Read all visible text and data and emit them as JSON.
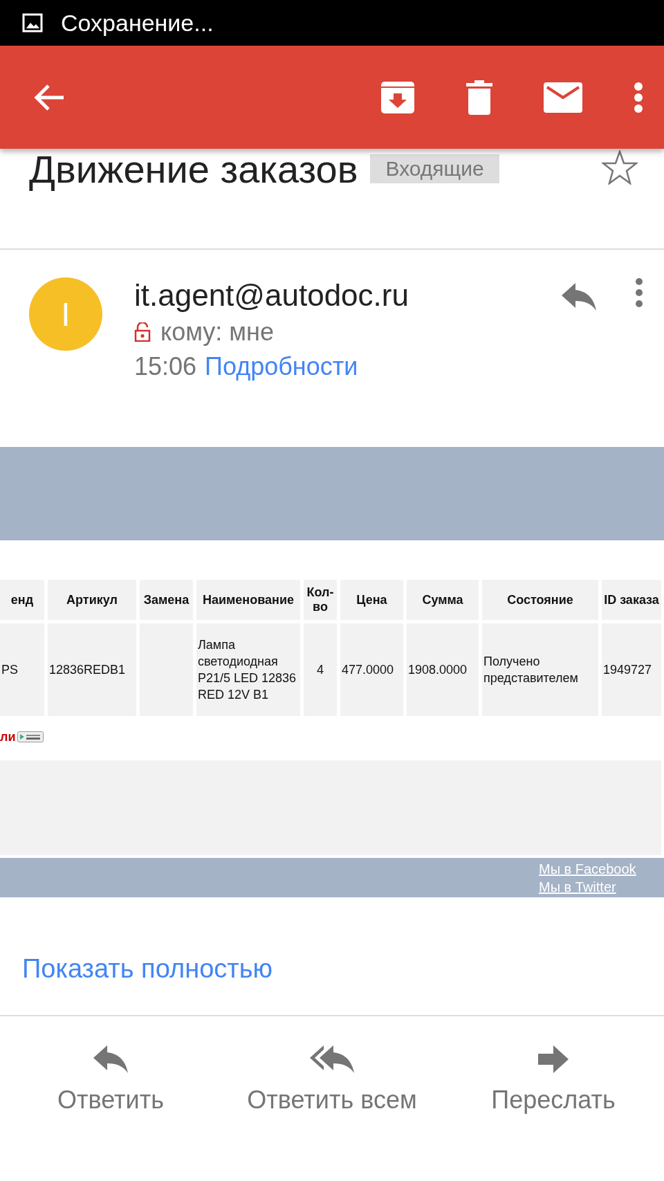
{
  "status_bar": {
    "text": "Сохранение..."
  },
  "subject": {
    "title": "Движение заказов",
    "label": "Входящие",
    "starred": false
  },
  "message": {
    "avatar_letter": "I",
    "sender": "it.agent@autodoc.ru",
    "recipient": "кому: мне",
    "time": "15:06",
    "details_link": "Подробности"
  },
  "table": {
    "columns": [
      "енд",
      "Артикул",
      "Замена",
      "Наименование",
      "Кол-во",
      "Цена",
      "Сумма",
      "Состояние",
      "ID заказа"
    ],
    "rows": [
      [
        "PS",
        "12836REDB1",
        "",
        "Лампа светодиодная P21/5 LED 12836 RED 12V B1",
        "4",
        "477.0000",
        "1908.0000",
        "Получено представителем",
        "1949727"
      ]
    ]
  },
  "app_promo": {
    "text": "ли"
  },
  "footer_links": [
    "Мы в Facebook",
    "Мы в Twitter"
  ],
  "show_full": "Показать полностью",
  "actions": [
    {
      "kind": "reply",
      "label": "Ответить"
    },
    {
      "kind": "reply_all",
      "label": "Ответить всем"
    },
    {
      "kind": "forward",
      "label": "Переслать"
    }
  ]
}
